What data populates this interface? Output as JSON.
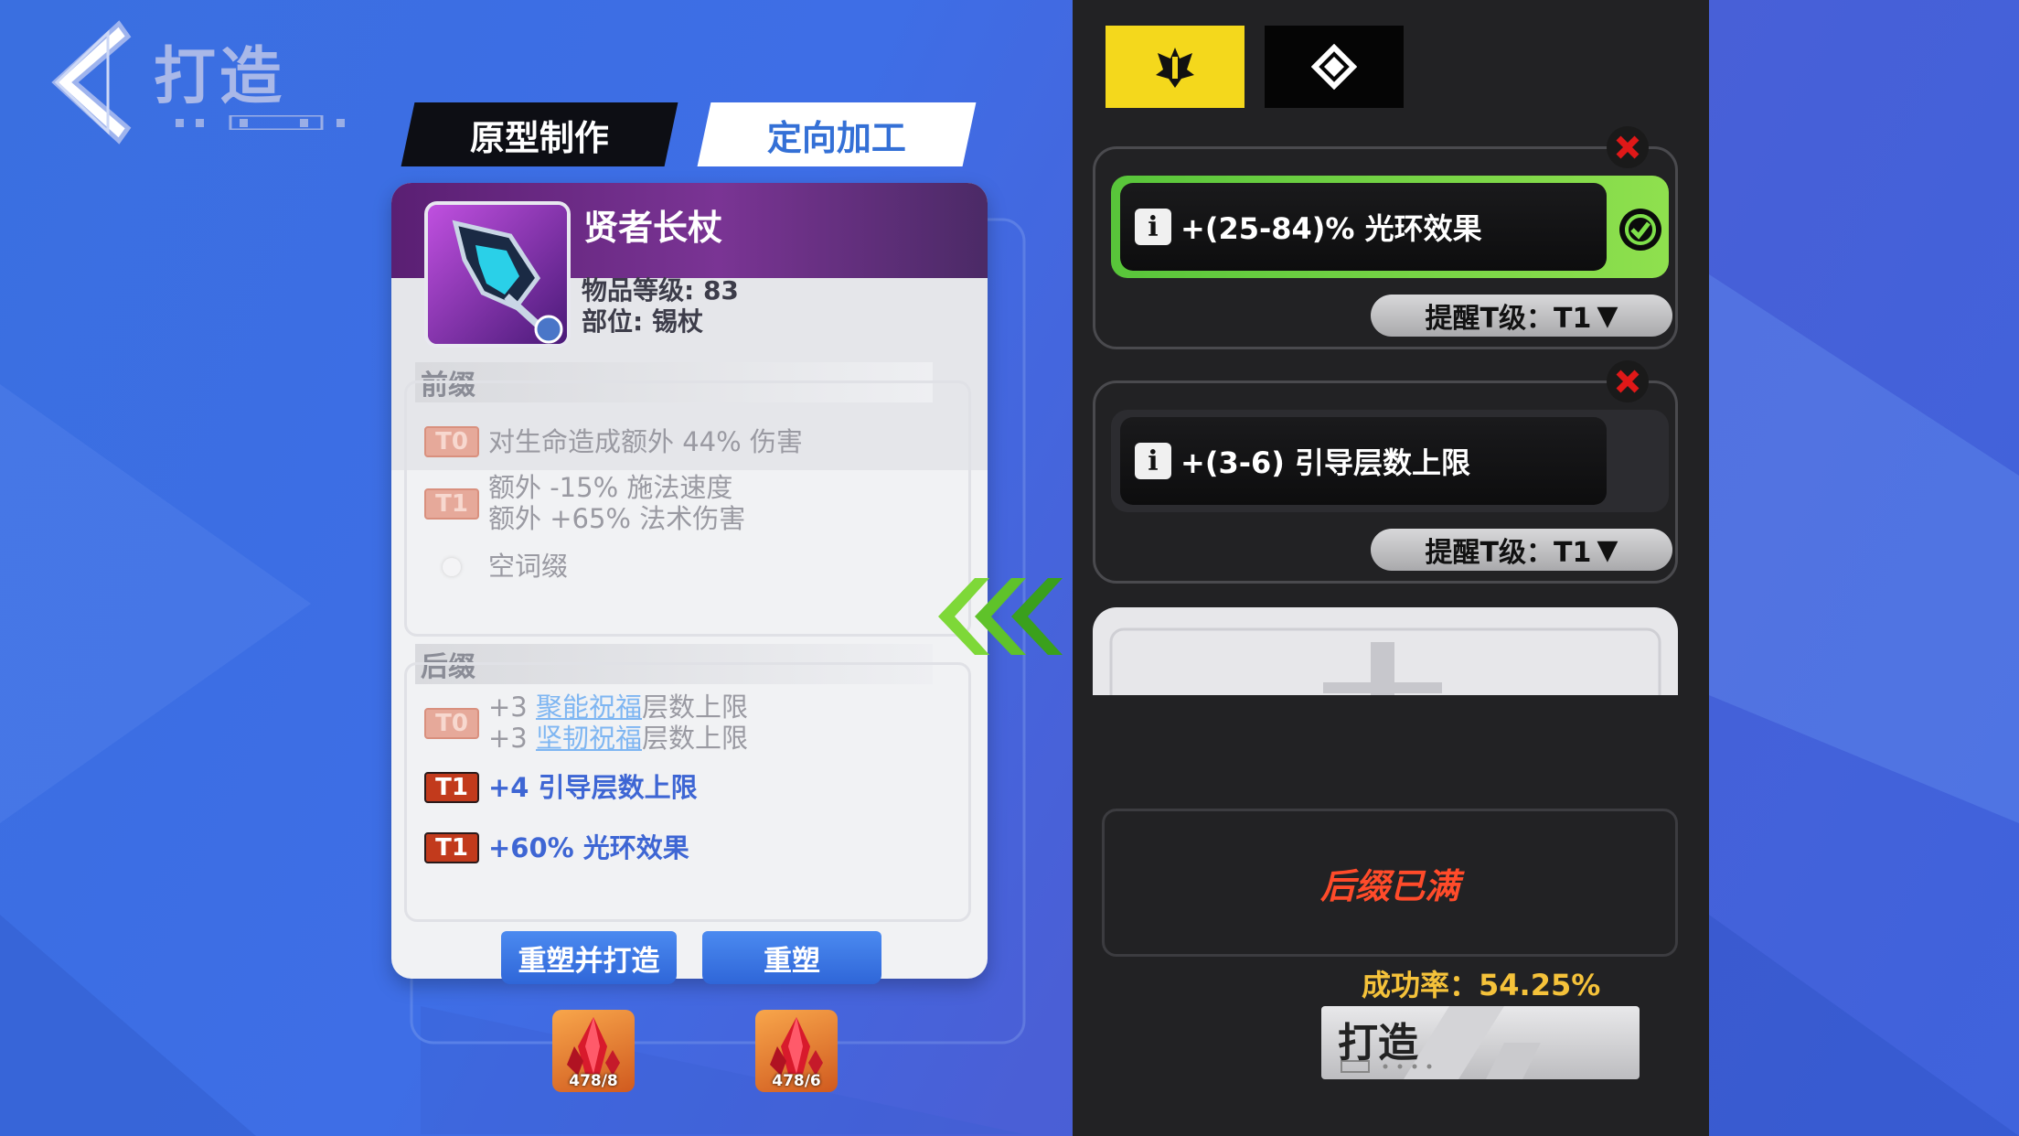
{
  "header": {
    "title": "打造",
    "back_icon": "chevron-left-icon"
  },
  "tabs": [
    {
      "label": "原型制作",
      "active": false
    },
    {
      "label": "定向加工",
      "active": true
    }
  ],
  "item": {
    "name": "贤者长杖",
    "level_label": "物品等级: 83",
    "slot_label": "部位: 锡杖",
    "prefix_title": "前缀",
    "prefixes": [
      {
        "tier": "T0",
        "lines": [
          "对生命造成额外 44% 伤害"
        ]
      },
      {
        "tier": "T1",
        "lines": [
          "额外 -15% 施法速度",
          "额外 +65% 法术伤害"
        ]
      }
    ],
    "empty_affix": "空词缀",
    "suffix_title": "后缀",
    "suffix_t0": {
      "tier": "T0",
      "line1_pre": "+3 ",
      "line1_kw": "聚能祝福",
      "line1_post": "层数上限",
      "line2_pre": "+3 ",
      "line2_kw": "坚韧祝福",
      "line2_post": "层数上限"
    },
    "suffixes_active": [
      {
        "tier": "T1",
        "text": "+4 引导层数上限"
      },
      {
        "tier": "T1",
        "text": "+60% 光环效果"
      }
    ]
  },
  "actions": {
    "reshape_craft": "重塑并打造",
    "reshape": "重塑"
  },
  "materials": [
    {
      "count": "478/8"
    },
    {
      "count": "478/6"
    }
  ],
  "panel": {
    "side_tabs": [
      {
        "icon": "crest-icon",
        "active": true
      },
      {
        "icon": "diamond-icon",
        "active": false
      }
    ],
    "targets": [
      {
        "text": "+(25-84)% 光环效果",
        "selected": true,
        "remind": "提醒T级：T1"
      },
      {
        "text": "+(3-6) 引导层数上限",
        "selected": false,
        "remind": "提醒T级：T1"
      }
    ],
    "full_message": "后缀已满",
    "success_rate": "成功率：54.25%",
    "craft_button": "打造"
  },
  "colors": {
    "accent_yellow": "#f4d81c",
    "success_green": "#58c53a",
    "warning_red": "#ff4b2a",
    "affix_blue": "#3e66d4"
  }
}
